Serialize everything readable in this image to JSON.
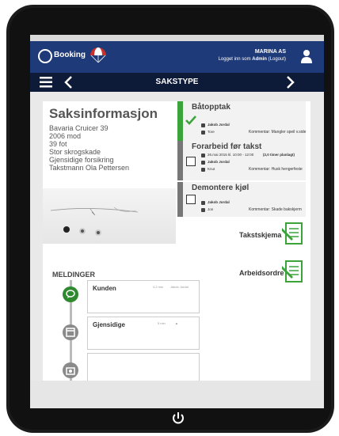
{
  "header": {
    "logo_text": "Booking",
    "logo_subtext": "",
    "company": "MARINA AS",
    "logged_in_prefix": "Logget inn som",
    "user_name": "Admin",
    "logout_label": "(Logout)"
  },
  "nav": {
    "title": "SAKSTYPE"
  },
  "info": {
    "title": "Saksinformasjon",
    "lines": [
      "Bavaria Cruicer 39",
      "2006 mod",
      "39 fot",
      "Stor skrogskade",
      "Gjensidige forsikring",
      "Takstmann Ola Pettersen"
    ]
  },
  "tasks": [
    {
      "title": "Båtopptak",
      "bar_color": "#3aa33a",
      "status": "done",
      "person": "Jakob Jordal",
      "worker": "Tore",
      "comment": "Kommentar: Mangler speil v.side"
    },
    {
      "title": "Forarbeid før takst",
      "bar_color": "#777777",
      "status": "open",
      "date": "26.mai 2015  kl. 10:00 - 12:00",
      "duration": "(2,0 timer planlagt)",
      "person": "Jakob Jordal",
      "worker": "Knut",
      "comment": "Kommentar: Husk hengerfeste"
    },
    {
      "title": "Demontere kjøl",
      "bar_color": "#777777",
      "status": "open",
      "person": "Jakob Jordal",
      "worker": "Jon",
      "comment": "Kommentar: Skade bakskjerm"
    }
  ],
  "docs": {
    "takstskjema": "Takstskjema",
    "arbeidsordre": "Arbeidsordre"
  },
  "messages": {
    "title": "MELDINGER",
    "items": [
      {
        "title": "Kunden",
        "age": "4.2 min",
        "author": "Jakob Jordal",
        "icon": "chat-icon",
        "color": "#2f8a2f"
      },
      {
        "title": "Gjensidige",
        "age": "5 min",
        "author": "",
        "icon": "calendar-icon",
        "color": "#8a8a8a"
      },
      {
        "title": "",
        "age": "",
        "author": "",
        "icon": "camera-icon",
        "color": "#8a8a8a"
      }
    ]
  },
  "colors": {
    "header_bg": "#1f3a78",
    "nav_bg": "#0d1a38",
    "accent_green": "#3aa33a"
  }
}
